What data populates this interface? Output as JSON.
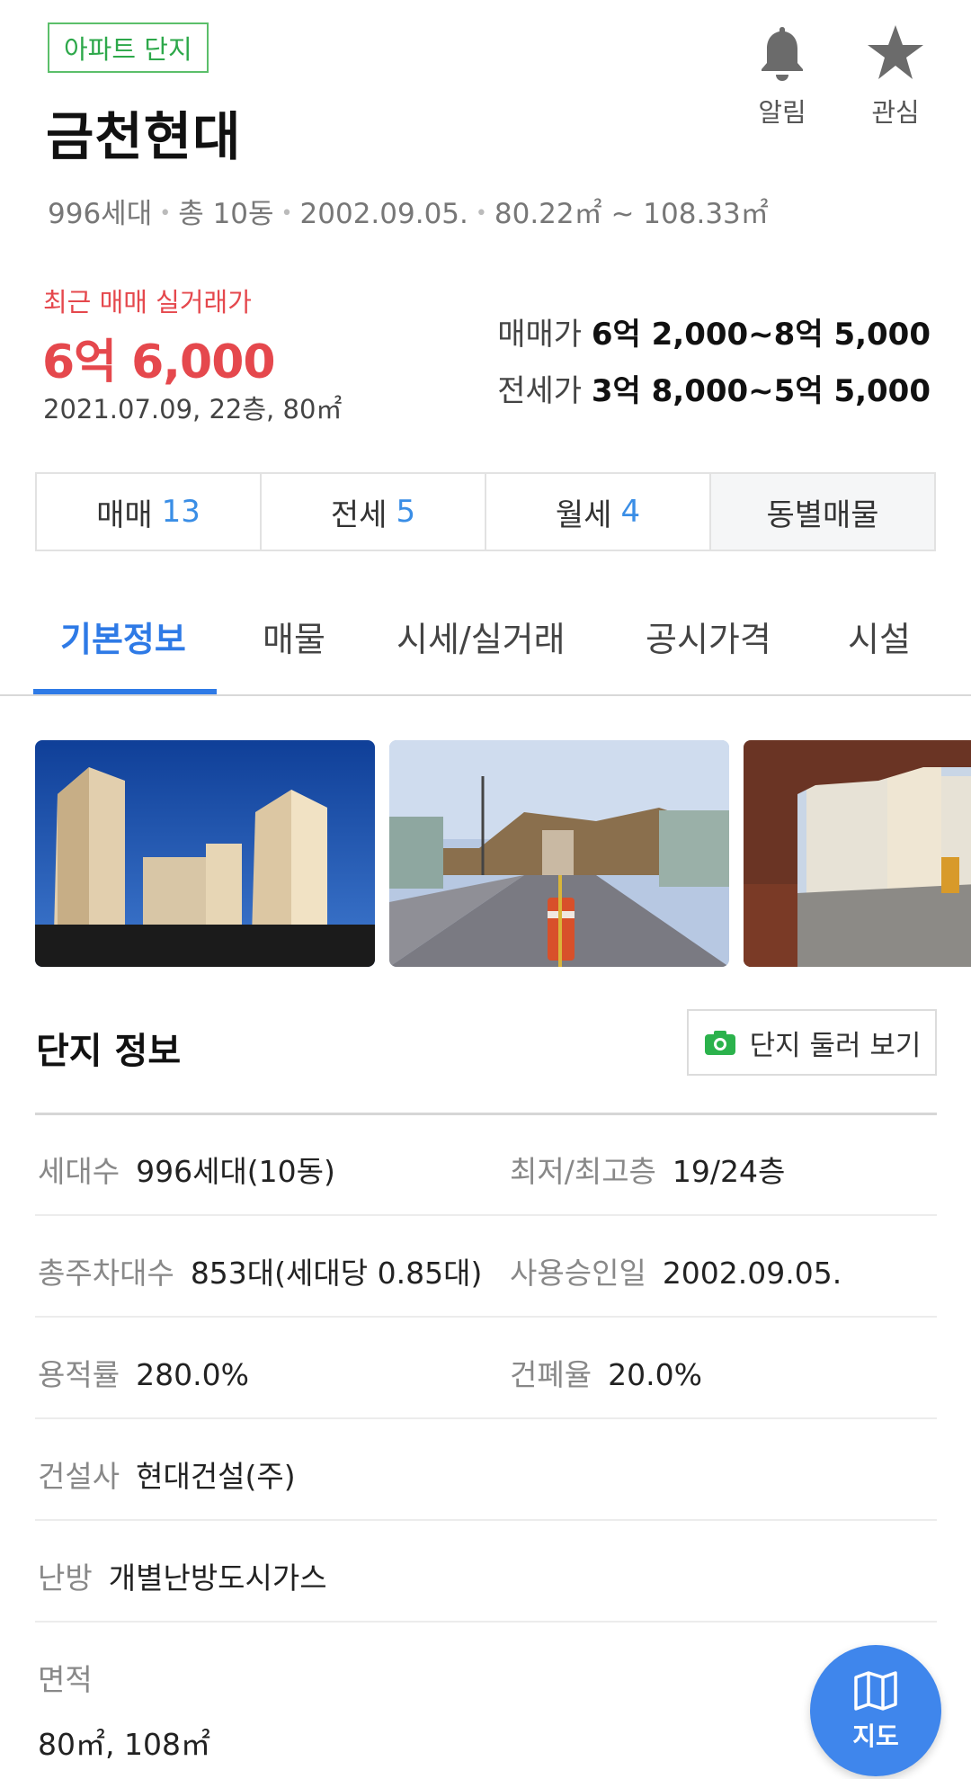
{
  "header": {
    "tag": "아파트 단지",
    "title": "금천현대",
    "alarm_label": "알림",
    "favorite_label": "관심",
    "meta": [
      "996세대",
      "총 10동",
      "2002.09.05.",
      "80.22㎡ ~ 108.33㎡"
    ]
  },
  "price": {
    "recent_label": "최근 매매 실거래가",
    "recent_value": "6억 6,000",
    "recent_detail": "2021.07.09, 22층, 80㎡",
    "sale_label": "매매가",
    "sale_range": "6억 2,000~8억 5,000",
    "jeonse_label": "전세가",
    "jeonse_range": "3억 8,000~5억 5,000"
  },
  "trade_tabs": [
    {
      "label": "매매",
      "count": "13"
    },
    {
      "label": "전세",
      "count": "5"
    },
    {
      "label": "월세",
      "count": "4"
    },
    {
      "label": "동별매물",
      "count": ""
    }
  ],
  "tabs": [
    "기본정보",
    "매물",
    "시세/실거래",
    "공시가격",
    "시설"
  ],
  "active_tab": "기본정보",
  "section": {
    "title": "단지 정보",
    "tour_button": "단지 둘러 보기"
  },
  "info": {
    "households_k": "세대수",
    "households_v": "996세대(10동)",
    "floors_k": "최저/최고층",
    "floors_v": "19/24층",
    "parking_k": "총주차대수",
    "parking_v": "853대(세대당 0.85대)",
    "approval_k": "사용승인일",
    "approval_v": "2002.09.05.",
    "far_k": "용적률",
    "far_v": "280.0%",
    "bcr_k": "건폐율",
    "bcr_v": "20.0%",
    "builder_k": "건설사",
    "builder_v": "현대건설(주)",
    "heating_k": "난방",
    "heating_v": "개별난방도시가스",
    "area_k": "면적",
    "area_v": "80㎡, 108㎡"
  },
  "fab": {
    "label": "지도"
  },
  "colors": {
    "accent_blue": "#2e7ae6",
    "price_red": "#e5484d",
    "tag_green": "#2da84a"
  }
}
